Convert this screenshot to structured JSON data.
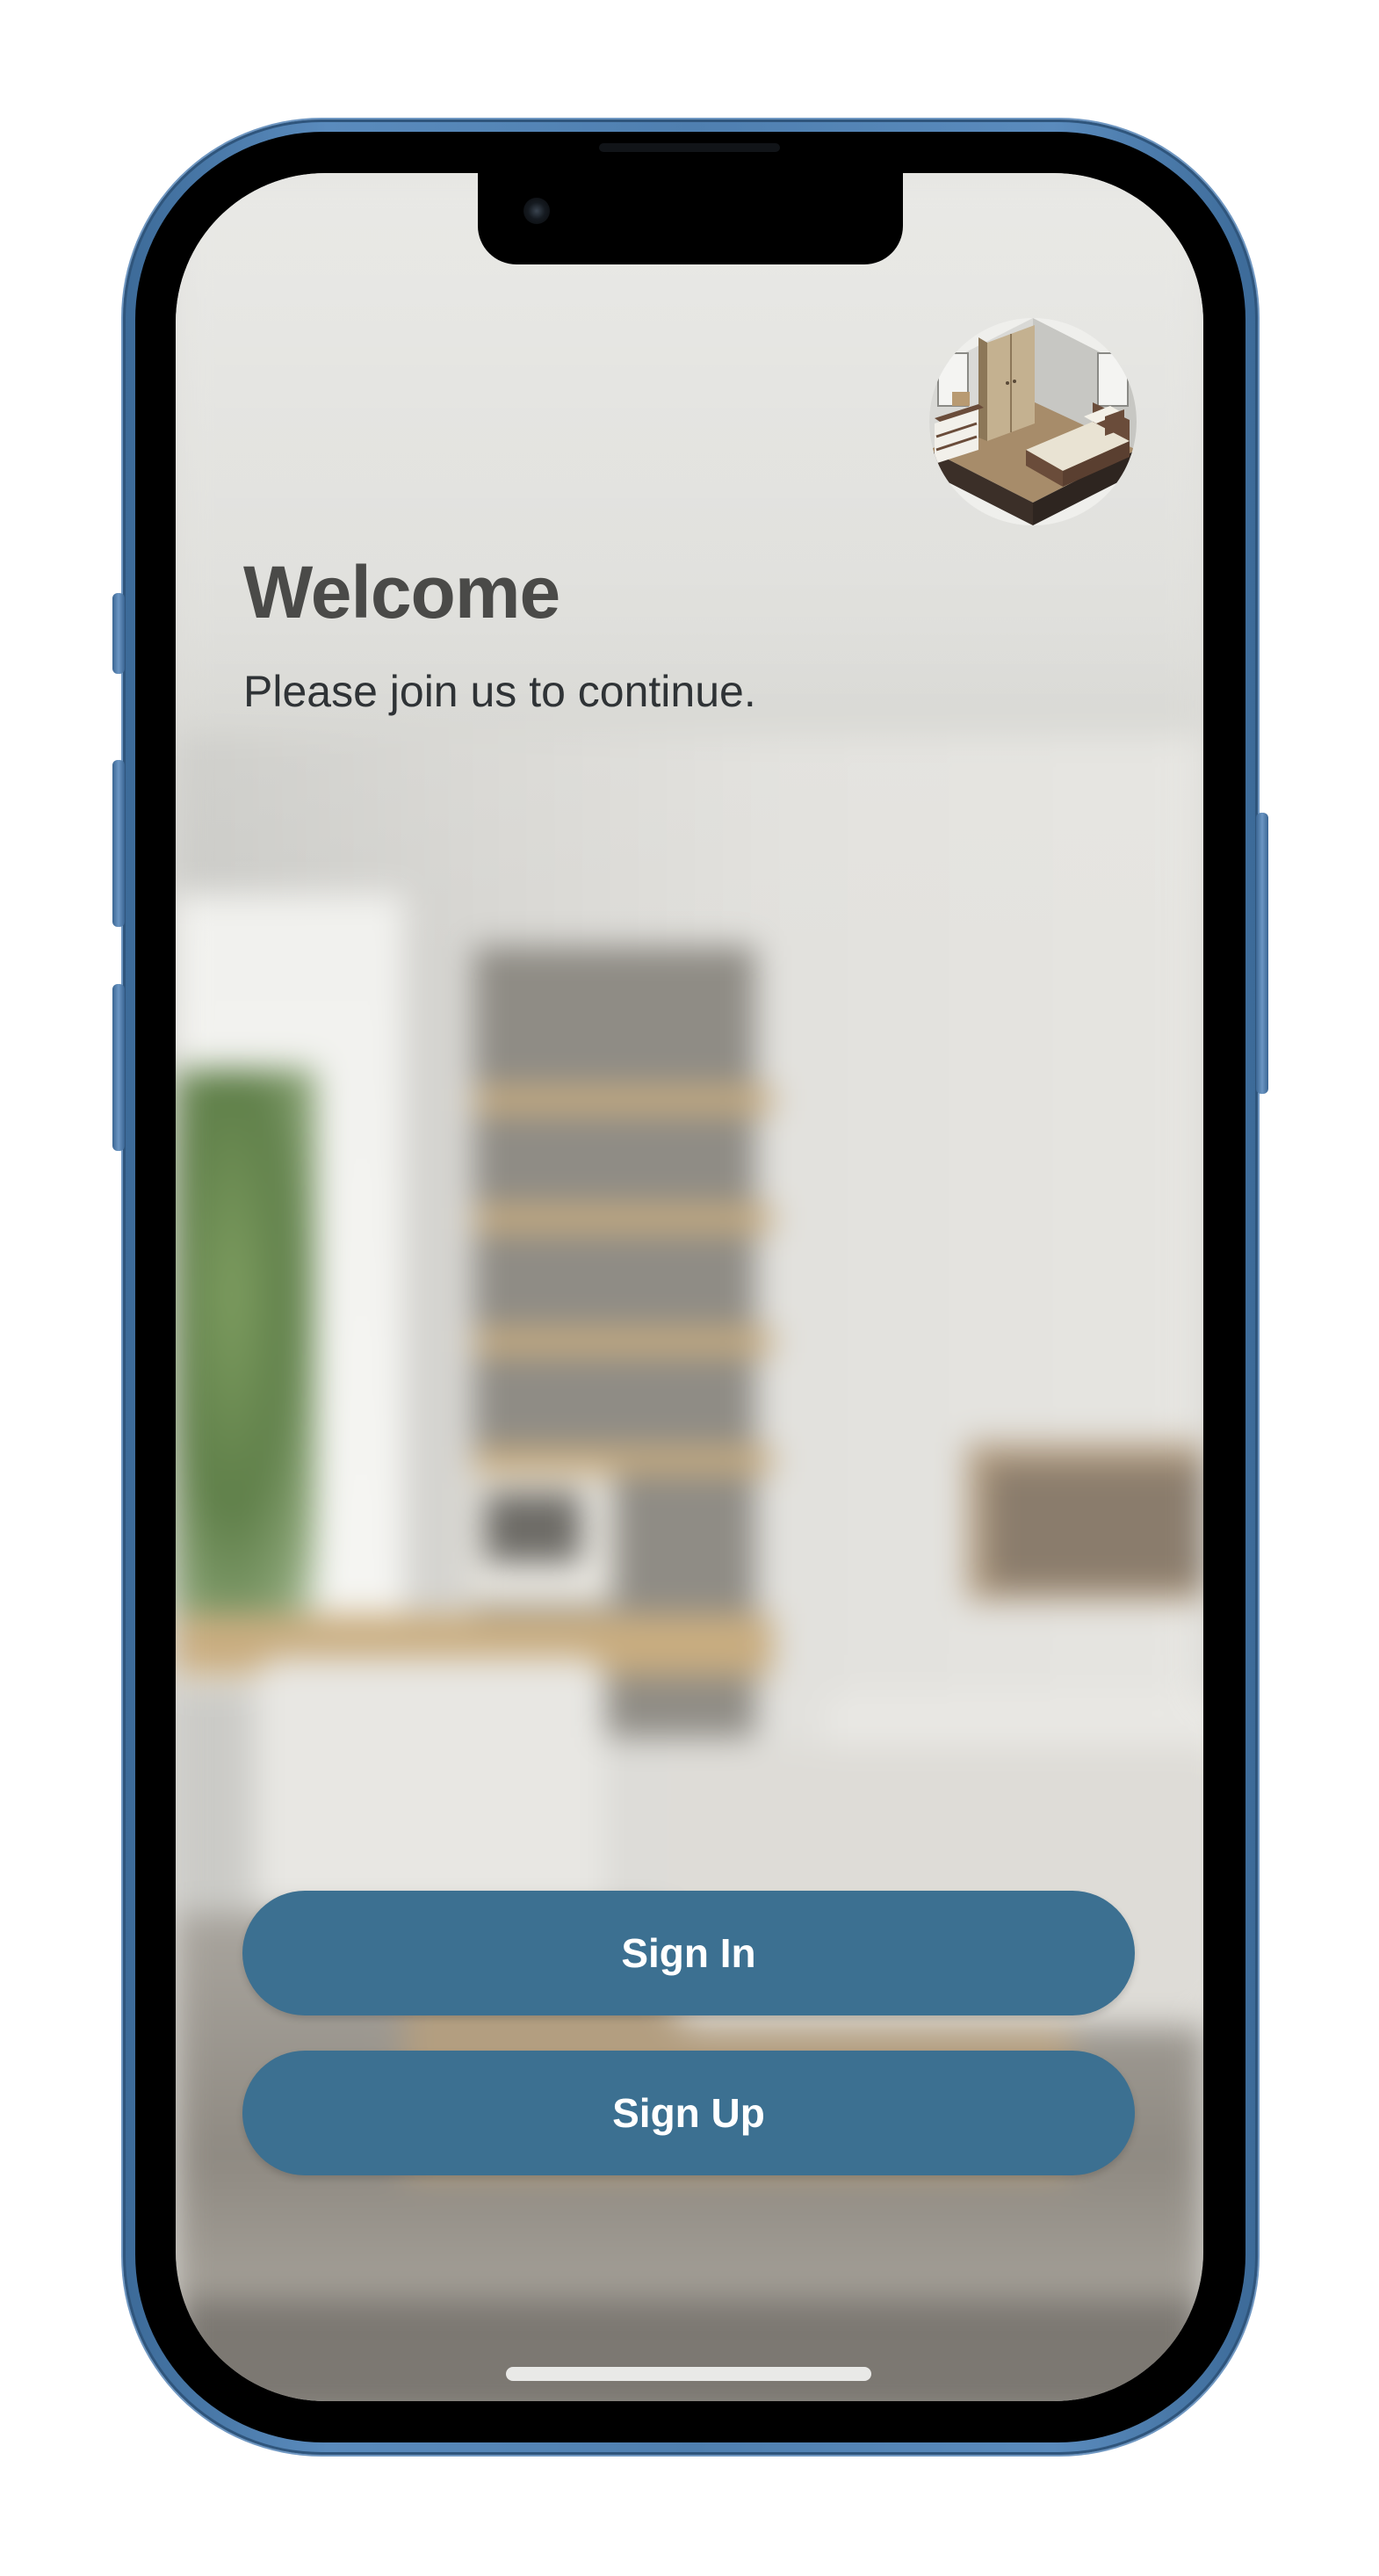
{
  "screen": {
    "title": "Welcome",
    "subtitle": "Please join us to continue.",
    "logo_icon": "bedroom-isometric-icon",
    "background": "blurred-living-room-photo"
  },
  "actions": {
    "sign_in_label": "Sign In",
    "sign_up_label": "Sign Up"
  },
  "colors": {
    "button": "#3c7091",
    "button_text": "#ffffff",
    "title": "#4a4a48",
    "subtitle": "#2f3336",
    "device_frame": "#4f7fb0"
  }
}
